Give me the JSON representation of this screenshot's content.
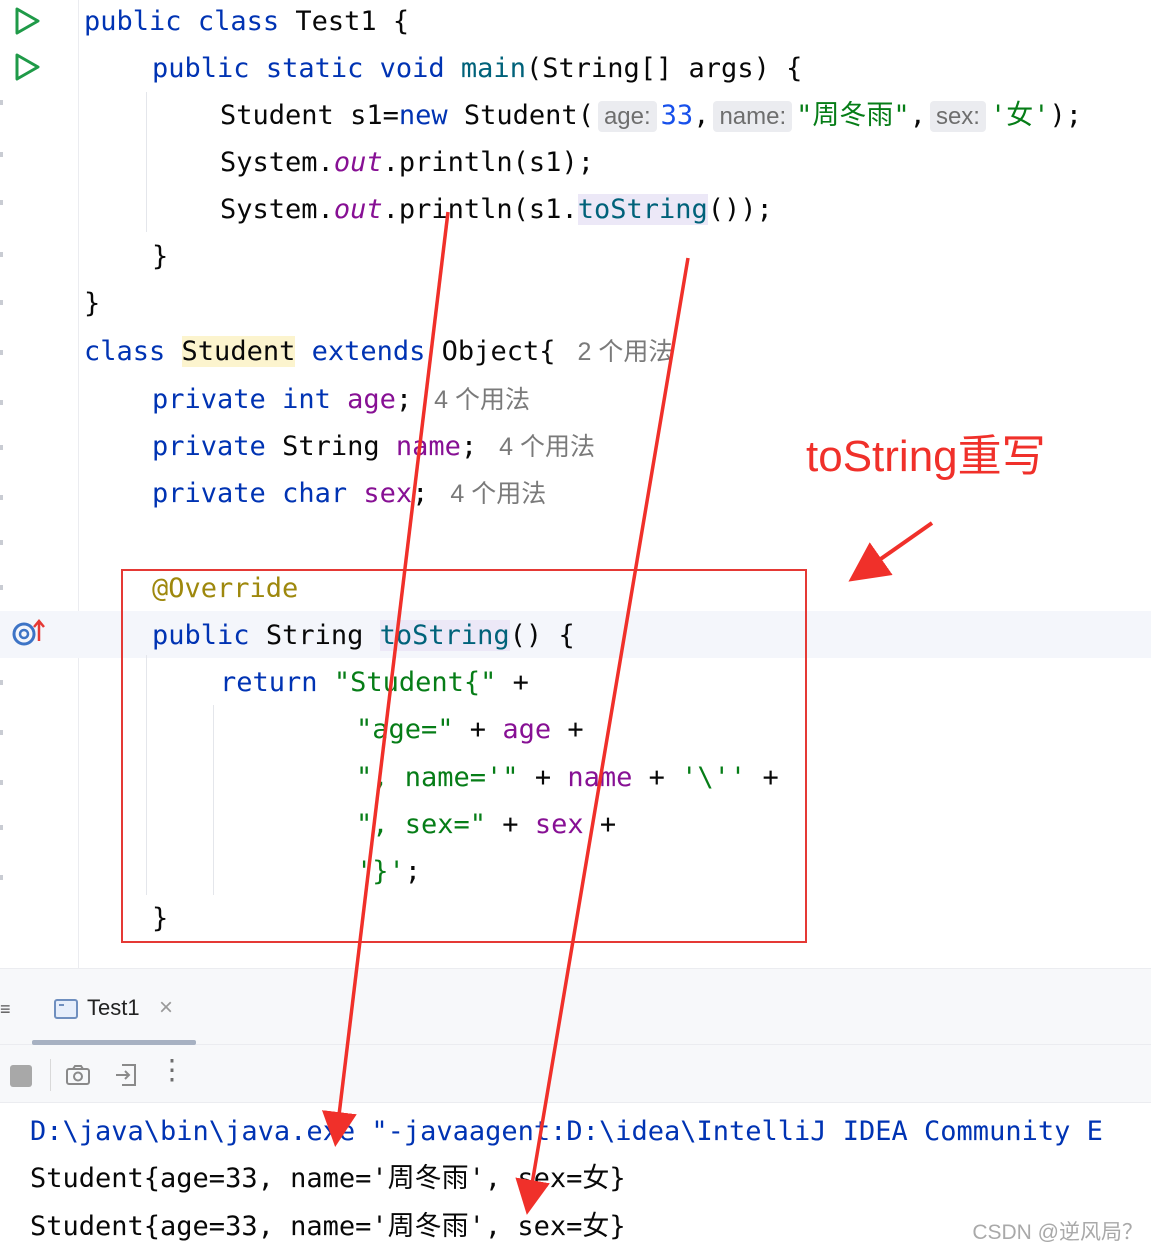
{
  "editor": {
    "usage_4": "4 个用法",
    "usage_2": "2 个用法",
    "hints": {
      "age": "age:",
      "name": "name:",
      "sex": "sex:"
    },
    "code": {
      "kw_public": "public",
      "kw_class": "class",
      "kw_static": "static",
      "kw_void": "void",
      "kw_new": "new",
      "kw_extends": "extends",
      "kw_private": "private",
      "kw_int": "int",
      "kw_char": "char",
      "kw_return": "return",
      "cls_test1": "Test1",
      "cls_student": "Student",
      "cls_object": "Object",
      "type_string": "String",
      "fn_main": "main",
      "fn_println": "println",
      "fn_tostring": "toString",
      "var_args": "args",
      "var_s1": "s1",
      "sys": "System",
      "out": "out",
      "fld_age": "age",
      "fld_name": "name",
      "fld_sex": "sex",
      "num_33": "33",
      "str_name_val": "\"周冬雨\"",
      "chr_sex_val": "'女'",
      "annotation": "@Override",
      "str_student_open": "\"Student{\"",
      "str_age": "\"age=\"",
      "str_name": "\", name='\"",
      "chr_quote": "'\\''",
      "str_sex": "\", sex=\"",
      "chr_close": "'}'"
    }
  },
  "annotation_label": "toString重写",
  "run_panel": {
    "tab_label": "Test1",
    "tab_close": "×",
    "side_mark": "≡",
    "more_glyph": "⋮",
    "output": [
      "D:\\java\\bin\\java.exe \"-javaagent:D:\\idea\\IntelliJ IDEA Community E",
      "Student{age=33, name='周冬雨', sex=女}",
      "Student{age=33, name='周冬雨', sex=女}"
    ]
  },
  "watermark": "CSDN @逆风局？",
  "colors": {
    "keyword": "#0033b3",
    "string": "#067d17",
    "field": "#871094",
    "number": "#1750eb",
    "annotation": "#9e880d",
    "highlight_red": "#e53935",
    "run_green": "#1f9a48"
  }
}
